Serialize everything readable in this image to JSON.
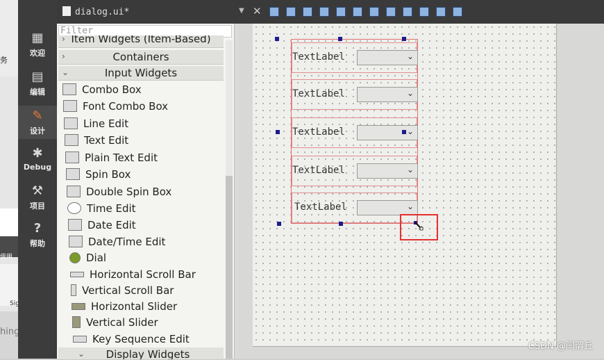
{
  "app": {
    "document_title": "dialog.ui*"
  },
  "mode_bar": [
    {
      "label": "欢迎",
      "icon": "grid-icon"
    },
    {
      "label": "编辑",
      "icon": "document-icon"
    },
    {
      "label": "设计",
      "icon": "pencil-icon"
    },
    {
      "label": "Debug",
      "icon": "bug-icon"
    },
    {
      "label": "项目",
      "icon": "wrench-icon"
    },
    {
      "label": "帮助",
      "icon": "help-icon"
    }
  ],
  "left_strip": {
    "texts": [
      "务",
      "使用",
      "Sig",
      "hing"
    ]
  },
  "widget_box": {
    "filter_placeholder": "Filter",
    "categories": {
      "item_widgets": "Item Widgets (Item-Based)",
      "containers": "Containers",
      "input_widgets": "Input Widgets",
      "display_widgets": "Display Widgets"
    },
    "input_widgets": [
      {
        "label": "Combo Box",
        "icon": "combo-box-icon"
      },
      {
        "label": "Font Combo Box",
        "icon": "font-combo-box-icon"
      },
      {
        "label": "Line Edit",
        "icon": "line-edit-icon"
      },
      {
        "label": "Text Edit",
        "icon": "text-edit-icon"
      },
      {
        "label": "Plain Text Edit",
        "icon": "plain-text-edit-icon"
      },
      {
        "label": "Spin Box",
        "icon": "spin-box-icon"
      },
      {
        "label": "Double Spin Box",
        "icon": "double-spin-box-icon"
      },
      {
        "label": "Time Edit",
        "icon": "clock-icon"
      },
      {
        "label": "Date Edit",
        "icon": "calendar-icon"
      },
      {
        "label": "Date/Time Edit",
        "icon": "datetime-icon"
      },
      {
        "label": "Dial",
        "icon": "dial-icon"
      },
      {
        "label": "Horizontal Scroll Bar",
        "icon": "hscrollbar-icon"
      },
      {
        "label": "Vertical Scroll Bar",
        "icon": "vscrollbar-icon"
      },
      {
        "label": "Horizontal Slider",
        "icon": "hslider-icon"
      },
      {
        "label": "Vertical Slider",
        "icon": "vslider-icon"
      },
      {
        "label": "Key Sequence Edit",
        "icon": "key-sequence-icon"
      }
    ]
  },
  "form": {
    "rows": [
      {
        "label": "TextLabel",
        "combo_value": ""
      },
      {
        "label": "TextLabel",
        "combo_value": ""
      },
      {
        "label": "TextLabel",
        "combo_value": ""
      },
      {
        "label": "TextLabel",
        "combo_value": ""
      },
      {
        "label": "TextLabel",
        "combo_value": ""
      }
    ]
  },
  "watermark": "CSDN @闫渭丘",
  "colors": {
    "highlight": "#e53030",
    "handle": "#1c1c8c",
    "layout_border": "#e07070",
    "active_mode_icon": "#e07a3a"
  }
}
